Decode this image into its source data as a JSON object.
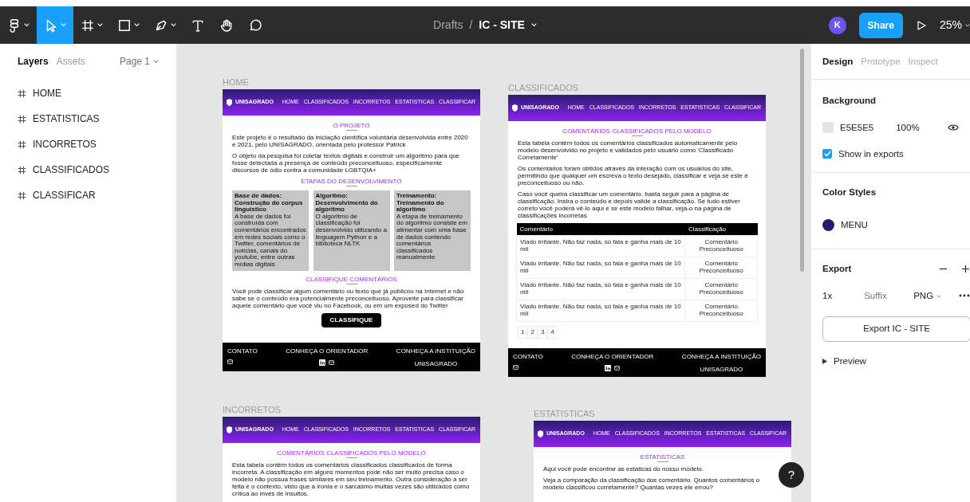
{
  "toolbar": {
    "tools": [
      {
        "kind": "menu",
        "dropdown": true,
        "selected": false
      },
      {
        "kind": "move",
        "dropdown": true,
        "selected": true
      },
      {
        "kind": "frame",
        "dropdown": true,
        "selected": false
      },
      {
        "kind": "shape",
        "dropdown": true,
        "selected": false
      },
      {
        "kind": "pen",
        "dropdown": true,
        "selected": false
      },
      {
        "kind": "text",
        "dropdown": false,
        "selected": false
      },
      {
        "kind": "hand",
        "dropdown": false,
        "selected": false
      },
      {
        "kind": "comment",
        "dropdown": false,
        "selected": false
      }
    ],
    "breadcrumb": {
      "folder": "Drafts",
      "separator": "/",
      "file": "IC - SITE"
    },
    "avatar": "K",
    "share": "Share",
    "zoom": "25%"
  },
  "left_panel": {
    "tabs": [
      {
        "label": "Layers",
        "selected": true
      },
      {
        "label": "Assets",
        "selected": false
      }
    ],
    "page": "Page 1",
    "layers": [
      {
        "name": "HOME",
        "selected": false
      },
      {
        "name": "ESTATISTICAS",
        "selected": false
      },
      {
        "name": "INCORRETOS",
        "selected": false
      },
      {
        "name": "CLASSIFICADOS",
        "selected": false
      },
      {
        "name": "CLASSIFICAR",
        "selected": false
      }
    ]
  },
  "canvas": {
    "frames": [
      {
        "label": "HOME",
        "nav": {
          "logo": "UNISAGRADO",
          "links": [
            "HOME",
            "CLASSIFICADOS",
            "INCORRETOS",
            "ESTATISTICAS",
            "CLASSIFICAR"
          ]
        },
        "sections": [
          {
            "kind": "heading",
            "text": "O PROJETO"
          },
          {
            "kind": "paragraph",
            "text": "Este projeto é o resultado da iniciação científica voluntária desenvolvida entre 2020 e 2021, pelo UNISAGRADO, orientada pelo professor Patrick"
          },
          {
            "kind": "paragraph",
            "text": "O objeto da pesquisa foi coletar textos digitais e construir um algoritmo para que fosse detectada a presença de conteúdo preconceituoso, especificamente discursos de ódio contra a comunidade LGBTQIA+"
          },
          {
            "kind": "heading",
            "text": "ETAPAS DO DESENVOLVIMENTO"
          },
          {
            "kind": "cards",
            "cards": [
              {
                "title": "Base de dados: Construção do corpus linguístico",
                "text": "A base de dados foi construída com comentários encontrados em redes sociais como o Twitter, comentários de notícias, canais do youtube, entre outras mídias digitais"
              },
              {
                "title": "Algoritmo: Desenvolvimento do algoritmo",
                "text": "O algoritmo de classificação foi desenvolvido utilizando a linguagem Python e a biblioteca NLTK"
              },
              {
                "title": "Treinamento: Treinamento do algoritmo",
                "text": "A etapa de treinamento do algoritmo consiste em alimentar com uma base de dados contendo comentários classificados manualmente"
              }
            ]
          },
          {
            "kind": "heading",
            "text": "CLASSIFIQUE COMENTÁRIOS"
          },
          {
            "kind": "paragraph",
            "text": "Você pode classificar algum comentário ou texto que já publicou na Internet e não sabe se o conteúdo era potencialmente preconceituoso. Aproveite para classificar aquele comentário que você viu no Facebook, ou em um exposed do Twitter"
          },
          {
            "kind": "button",
            "text": "CLASSIFIQUE"
          }
        ],
        "footer": [
          {
            "kind": "contact",
            "title": "CONTATO"
          },
          {
            "kind": "social",
            "title": "CONHEÇA O ORIENTADOR"
          },
          {
            "kind": "institution",
            "title": "CONHEÇA A INSTITUIÇÃO",
            "text": "UNISAGRADO"
          }
        ]
      },
      {
        "label": "CLASSIFICADOS",
        "nav": {
          "logo": "UNISAGRADO",
          "links": [
            "HOME",
            "CLASSIFICADOS",
            "INCORRETOS",
            "ESTATISTICAS",
            "CLASSIFICAR"
          ]
        },
        "sections": [
          {
            "kind": "heading",
            "text": "COMENTÁRIOS CLASSIFICADOS PELO MODELO"
          },
          {
            "kind": "paragraph",
            "text": "Esta tabela contém todos os comentários classificados automaticamente pelo modelo desenvolvido no projeto e validados pelo usuário como 'Classificado Corretamente'"
          },
          {
            "kind": "paragraph",
            "text": "Os comentários foram obtidos através da interação com os usuários do site, permitindo que qualquer um escreva o texto desejado, classificar e veja se este é preconceituoso ou não."
          },
          {
            "kind": "paragraph",
            "text": "Caso você queira classificar um comentário, basta seguir para a página de classificação. Insira o conteúdo e depois valide a classificação. Se tudo estiver correto você poderá vê-lo aqui e se este modelo falhar, veja-o na página de classificações incorretas"
          },
          {
            "kind": "table",
            "columns": [
              "Comentário",
              "Classificação"
            ],
            "rows": [
              [
                "Viado irritante. Não faz nada, só fala e ganha mais de 10 mil",
                "Comentário Preconceituoso"
              ],
              [
                "Viado irritante. Não faz nada, só fala e ganha mais de 10 mil",
                "Comentário Preconceituoso"
              ],
              [
                "Viado irritante. Não faz nada, só fala e ganha mais de 10 mil",
                "Comentário Preconceituoso"
              ],
              [
                "Viado irritante. Não faz nada, só fala e ganha mais de 10 mil",
                "Comentário Preconceituoso"
              ]
            ]
          },
          {
            "kind": "pagination",
            "pages": [
              "1",
              "2",
              "3",
              "4"
            ]
          }
        ],
        "footer": [
          {
            "kind": "contact",
            "title": "CONTATO"
          },
          {
            "kind": "social",
            "title": "CONHEÇA O ORIENTADOR"
          },
          {
            "kind": "institution",
            "title": "CONHEÇA A INSTITUIÇÃO",
            "text": "UNISAGRADO"
          }
        ]
      },
      {
        "label": "INCORRETOS",
        "nav": {
          "logo": "UNISAGRADO",
          "links": [
            "HOME",
            "CLASSIFICADOS",
            "INCORRETOS",
            "ESTATISTICAS",
            "CLASSIFICAR"
          ]
        },
        "sections": [
          {
            "kind": "heading",
            "text": "COMENTÁRIOS CLASSIFICADOS PELO MODELO"
          },
          {
            "kind": "paragraph",
            "text": "Esta tabela contém todos os comentários classificados classificados de forma incorreta. A classificação em alguns momentos pode não ser muito precisa caso o modelo não possua frases similares em seu treinamento. Outra consideração a ser feita é o contexto, visto que a ironia e o sarcasmo muitas vezes são utilizados como crítica ao invés de insultos."
          }
        ]
      },
      {
        "label": "ESTATISTICAS",
        "nav": {
          "logo": "UNISAGRADO",
          "links": [
            "HOME",
            "CLASSIFICADOS",
            "INCORRETOS",
            "ESTATISTICAS",
            "CLASSIFICAR"
          ]
        },
        "sections": [
          {
            "kind": "heading",
            "text": "ESTATISTICAS"
          },
          {
            "kind": "paragraph",
            "text": "Aqui você pode encontrar as estaticas do nosso modelo."
          },
          {
            "kind": "paragraph",
            "text": "Veja a comparação da classificação dos comentário. Quantos comentários o modelo classificou corretamente? Quantas vezes ele errou?"
          }
        ]
      }
    ]
  },
  "right_panel": {
    "tabs": [
      {
        "label": "Design",
        "selected": true
      },
      {
        "label": "Prototype",
        "selected": false
      },
      {
        "label": "Inspect",
        "selected": false
      }
    ],
    "background": {
      "title": "Background",
      "color": "E5E5E5",
      "opacity": "100%",
      "show_in_exports": {
        "label": "Show in exports",
        "checked": true
      }
    },
    "color_styles": {
      "title": "Color Styles",
      "styles": [
        {
          "name": "MENU",
          "color": "#2a1a6e"
        }
      ]
    },
    "export": {
      "title": "Export",
      "scale": "1x",
      "suffix_placeholder": "Suffix",
      "format": "PNG",
      "button": "Export IC - SITE",
      "preview": "Preview"
    }
  },
  "help_button": "?"
}
